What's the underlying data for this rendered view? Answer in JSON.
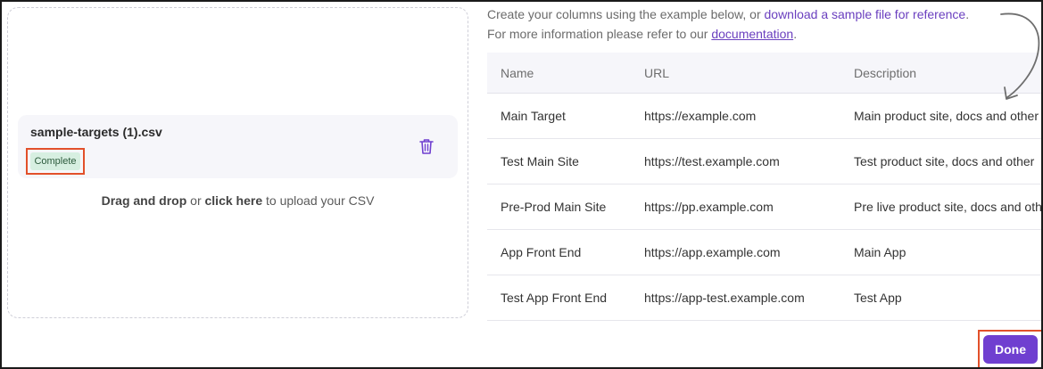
{
  "upload": {
    "file_name": "sample-targets (1).csv",
    "status": "Complete",
    "hint_drag": "Drag and drop",
    "hint_or": " or ",
    "hint_click": "click here",
    "hint_rest": " to upload your CSV"
  },
  "intro": {
    "line1_text": "Create your columns using the example below, or ",
    "line1_link": "download a sample file for reference",
    "line1_end": ".",
    "line2_text": "For more information please refer to our ",
    "line2_link": "documentation",
    "line2_end": "."
  },
  "table": {
    "headers": [
      "Name",
      "URL",
      "Description"
    ],
    "rows": [
      [
        "Main Target",
        "https://example.com",
        "Main product site, docs and other"
      ],
      [
        "Test Main Site",
        "https://test.example.com",
        "Test product site, docs and other"
      ],
      [
        "Pre-Prod Main Site",
        "https://pp.example.com",
        "Pre live product site, docs and other"
      ],
      [
        "App Front End",
        "https://app.example.com",
        "Main App"
      ],
      [
        "Test App Front End",
        "https://app-test.example.com",
        "Test App"
      ]
    ]
  },
  "actions": {
    "done_label": "Done"
  },
  "colors": {
    "accent": "#6f3fd0",
    "link": "#6a3fbf",
    "highlight": "#e2502a",
    "badge_bg": "#d7efe1"
  },
  "icons": {
    "delete": "trash-icon",
    "pointer": "curved-arrow-icon"
  }
}
